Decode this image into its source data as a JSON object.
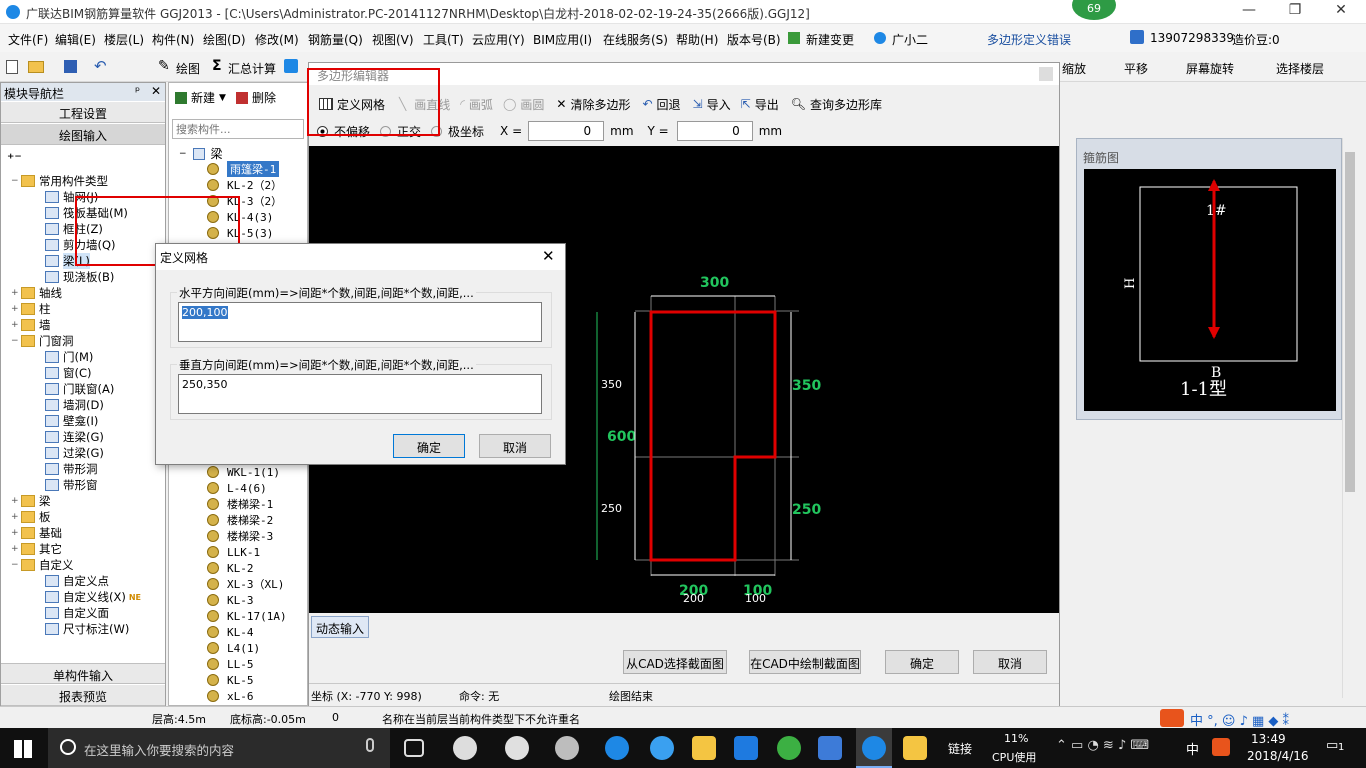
{
  "window": {
    "title": "广联达BIM钢筋算量软件 GGJ2013 - [C:\\Users\\Administrator.PC-20141127NRHM\\Desktop\\白龙村-2018-02-02-19-24-35(2666版).GGJ12]",
    "badge": "69",
    "minimize": "—",
    "restore": "❐",
    "close": "✕"
  },
  "menu": {
    "items": [
      "文件(F)",
      "编辑(E)",
      "楼层(L)",
      "构件(N)",
      "绘图(D)",
      "修改(M)",
      "钢筋量(Q)",
      "视图(V)",
      "工具(T)",
      "云应用(Y)",
      "BIM应用(I)",
      "在线服务(S)",
      "帮助(H)",
      "版本号(B)",
      "新建变更",
      "广小二"
    ],
    "error_link": "多边形定义错误",
    "phone": "13907298339",
    "price": "造价豆:0"
  },
  "toolbar": {
    "draw": "绘图",
    "sum": "汇总计算",
    "right_items": [
      "缩放",
      "平移",
      "屏幕旋转",
      "选择楼层"
    ]
  },
  "nav": {
    "title": "模块导航栏",
    "pin": "ᵖ",
    "close": "✕",
    "project_settings": "工程设置",
    "drawing_input": "绘图输入",
    "tree": [
      {
        "label": "常用构件类型",
        "level": 0,
        "expand": "−",
        "type": "folder"
      },
      {
        "label": "轴网(J)",
        "level": 1,
        "type": "comp"
      },
      {
        "label": "筏板基础(M)",
        "level": 1,
        "type": "comp"
      },
      {
        "label": "框柱(Z)",
        "level": 1,
        "type": "comp"
      },
      {
        "label": "剪力墙(Q)",
        "level": 1,
        "type": "comp"
      },
      {
        "label": "梁(L)",
        "level": 1,
        "type": "comp",
        "selected": true
      },
      {
        "label": "现浇板(B)",
        "level": 1,
        "type": "comp"
      },
      {
        "label": "轴线",
        "level": 0,
        "expand": "+",
        "type": "folder"
      },
      {
        "label": "柱",
        "level": 0,
        "expand": "+",
        "type": "folder"
      },
      {
        "label": "墙",
        "level": 0,
        "expand": "+",
        "type": "folder"
      },
      {
        "label": "门窗洞",
        "level": 0,
        "expand": "−",
        "type": "folder"
      },
      {
        "label": "门(M)",
        "level": 1,
        "type": "comp"
      },
      {
        "label": "窗(C)",
        "level": 1,
        "type": "comp"
      },
      {
        "label": "门联窗(A)",
        "level": 1,
        "type": "comp"
      },
      {
        "label": "墙洞(D)",
        "level": 1,
        "type": "comp"
      },
      {
        "label": "壁龛(I)",
        "level": 1,
        "type": "comp"
      },
      {
        "label": "连梁(G)",
        "level": 1,
        "type": "comp"
      },
      {
        "label": "过梁(G)",
        "level": 1,
        "type": "comp"
      },
      {
        "label": "带形洞",
        "level": 1,
        "type": "comp"
      },
      {
        "label": "带形窗",
        "level": 1,
        "type": "comp"
      },
      {
        "label": "梁",
        "level": 0,
        "expand": "+",
        "type": "folder"
      },
      {
        "label": "板",
        "level": 0,
        "expand": "+",
        "type": "folder"
      },
      {
        "label": "基础",
        "level": 0,
        "expand": "+",
        "type": "folder"
      },
      {
        "label": "其它",
        "level": 0,
        "expand": "+",
        "type": "folder"
      },
      {
        "label": "自定义",
        "level": 0,
        "expand": "−",
        "type": "folder"
      },
      {
        "label": "自定义点",
        "level": 1,
        "type": "comp"
      },
      {
        "label": "自定义线(X)",
        "level": 1,
        "type": "comp",
        "new": "NE"
      },
      {
        "label": "自定义面",
        "level": 1,
        "type": "comp"
      },
      {
        "label": "尺寸标注(W)",
        "level": 1,
        "type": "comp"
      }
    ],
    "single_input": "单构件输入",
    "report_preview": "报表预览"
  },
  "complist": {
    "new": "新建",
    "delete": "删除",
    "search_placeholder": "搜索构件...",
    "root": "梁",
    "items_top": [
      "雨篷梁-1",
      "KL-2（2）",
      "KL-3（2）",
      "KL-4(3)",
      "KL-5(3)"
    ],
    "items_bottom": [
      "WKL-1(1)",
      "L-4(6)",
      "楼梯梁-1",
      "楼梯梁-2",
      "楼梯梁-3",
      "LLK-1",
      "KL-2",
      "XL-3（XL)",
      "KL-3",
      "KL-17(1A)",
      "KL-4",
      "L4(1)",
      "LL-5",
      "KL-5",
      "xL-6"
    ]
  },
  "poly": {
    "title": "多边形编辑器",
    "define_grid": "定义网格",
    "draw_line": "画直线",
    "draw_arc": "画弧",
    "draw_circle": "画圆",
    "clear": "清除多边形",
    "undo": "回退",
    "import": "导入",
    "export": "导出",
    "query": "查询多边形库",
    "opt_nooffset": "不偏移",
    "opt_ortho": "正交",
    "opt_polar": "极坐标",
    "x_label": "X =",
    "x_value": "0",
    "y_label": "Y =",
    "y_value": "0",
    "unit": "mm",
    "dyn_input": "动态输入",
    "btn_cad_select": "从CAD选择截面图",
    "btn_cad_draw": "在CAD中绘制截面图",
    "btn_ok": "确定",
    "btn_cancel": "取消",
    "coord": "坐标 (X: -770 Y: 998)",
    "command": "命令: 无",
    "status": "绘图结束",
    "dims": {
      "top": "300",
      "left_total": "600",
      "left_350": "350",
      "left_250": "250",
      "right_350": "350",
      "right_250": "250",
      "bottom_200": "200",
      "bottom_100": "100",
      "bottom_200_small": "200",
      "bottom_100_small": "100"
    }
  },
  "stirrup": {
    "title": "箍筋图",
    "label_1": "1#",
    "label_h": "H",
    "label_b": "B",
    "type": "1-1型"
  },
  "dialog": {
    "title": "定义网格",
    "close": "✕",
    "h_label": "水平方向间距(mm)=>间距*个数,间距,间距*个数,间距,...",
    "h_value": "200,100",
    "v_label": "垂直方向间距(mm)=>间距*个数,间距,间距*个数,间距,...",
    "v_value": "250,350",
    "ok": "确定",
    "cancel": "取消"
  },
  "statusbar": {
    "floor_height": "层高:4.5m",
    "base_height": "底标高:-0.05m",
    "zero": "0",
    "message": "名称在当前层当前构件类型下不允许重名"
  },
  "taskbar": {
    "search_placeholder": "在这里输入你要搜索的内容",
    "link": "链接",
    "cpu_pct": "11%",
    "cpu_label": "CPU使用",
    "ime": "中",
    "time": "13:49",
    "date": "2018/4/16",
    "notif": "1"
  },
  "colors": {
    "accent": "#1e88e5",
    "highlight_red": "#e00000",
    "cad_green": "#22c55e",
    "cad_bg": "#000000"
  }
}
